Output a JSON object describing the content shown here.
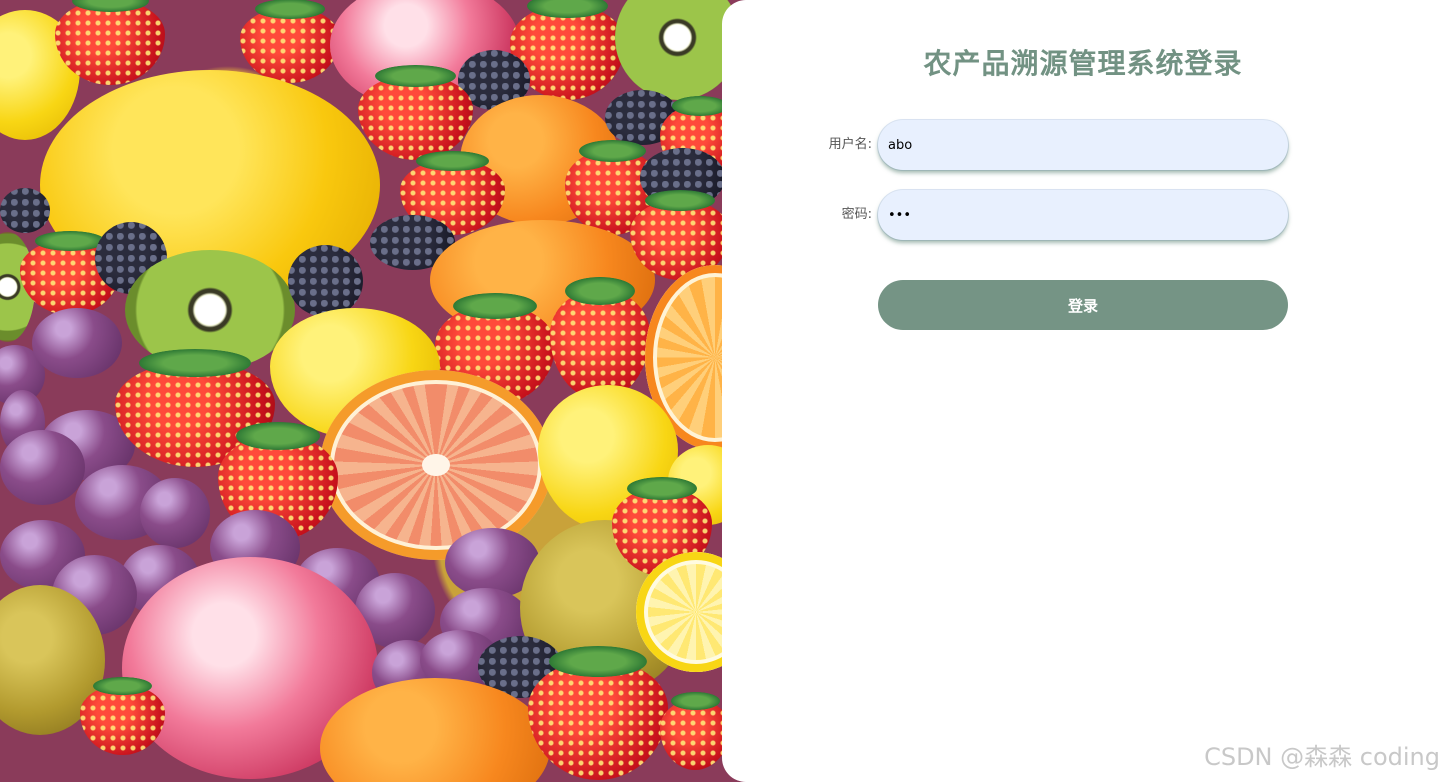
{
  "hero": {
    "image_description_icon": "fruit-background-image"
  },
  "login": {
    "title": "农产品溯源管理系统登录",
    "username_label": "用户名:",
    "username_value": "abo",
    "password_label": "密码:",
    "password_value": "abc",
    "submit_label": "登录"
  },
  "watermark": {
    "text": "CSDN @森森 coding"
  },
  "colors": {
    "accent": "#759485",
    "title": "#729283",
    "input_bg": "#e8f0fe"
  }
}
